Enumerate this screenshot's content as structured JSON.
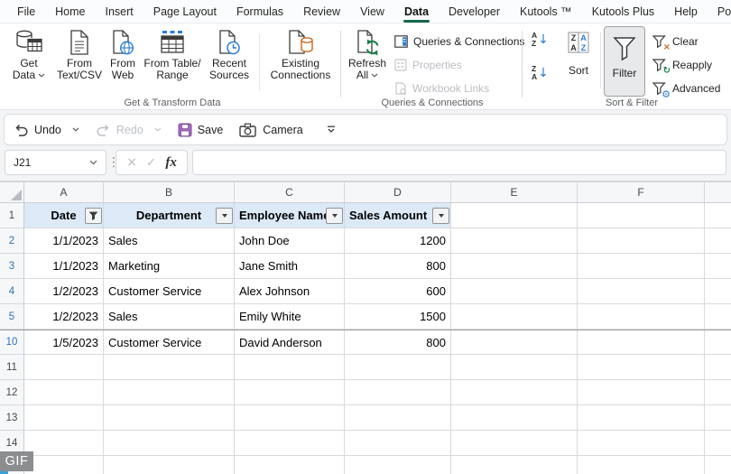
{
  "colors": {
    "accent_green": "#17694a",
    "table_header_fill": "#dce9f7",
    "filtered_row_number_blue": "#2f71b7",
    "blue_accent": "#2b7cd3",
    "orange_accent": "#c9671c",
    "green_refresh": "#17804a",
    "save_icon_purple": "#a86bc2"
  },
  "menu_tabs": {
    "items": [
      {
        "label": "File",
        "active": false
      },
      {
        "label": "Home",
        "active": false
      },
      {
        "label": "Insert",
        "active": false
      },
      {
        "label": "Page Layout",
        "active": false
      },
      {
        "label": "Formulas",
        "active": false
      },
      {
        "label": "Review",
        "active": false
      },
      {
        "label": "View",
        "active": false
      },
      {
        "label": "Data",
        "active": true
      },
      {
        "label": "Developer",
        "active": false
      },
      {
        "label": "Kutools ™",
        "active": false
      },
      {
        "label": "Kutools Plus",
        "active": false
      },
      {
        "label": "Help",
        "active": false
      },
      {
        "label": "Po",
        "active": false
      }
    ]
  },
  "ribbon": {
    "get_transform": {
      "group_label": "Get & Transform Data",
      "get_data": {
        "line1": "Get",
        "line2": "Data"
      },
      "from_text_csv": {
        "line1": "From",
        "line2": "Text/CSV"
      },
      "from_web": {
        "line1": "From",
        "line2": "Web"
      },
      "from_table_range": {
        "line1": "From Table/",
        "line2": "Range"
      },
      "recent_sources": {
        "line1": "Recent",
        "line2": "Sources"
      },
      "existing_connections": {
        "line1": "Existing",
        "line2": "Connections"
      }
    },
    "queries_connections": {
      "group_label": "Queries & Connections",
      "refresh_all": {
        "line1": "Refresh",
        "line2": "All"
      },
      "queries_connections_label": "Queries & Connections",
      "properties_label": "Properties",
      "workbook_links_label": "Workbook Links"
    },
    "sort_filter": {
      "group_label": "Sort & Filter",
      "sort_label": "Sort",
      "filter_label": "Filter",
      "clear_label": "Clear",
      "reapply_label": "Reapply",
      "advanced_label": "Advanced"
    }
  },
  "quick_access": {
    "undo_label": "Undo",
    "redo_label": "Redo",
    "save_label": "Save",
    "camera_label": "Camera"
  },
  "formula_bar": {
    "name_box_value": "J21",
    "cancel_glyph": "×",
    "enter_glyph": "✓",
    "fx_label": "fx",
    "formula_value": ""
  },
  "sheet": {
    "column_headers": [
      "A",
      "B",
      "C",
      "D",
      "E",
      "F",
      ""
    ],
    "header_row": {
      "row_number": "1",
      "cells": [
        {
          "text": "Date",
          "filter": "applied"
        },
        {
          "text": "Department",
          "filter": "dropdown"
        },
        {
          "text": "Employee Name",
          "filter": "dropdown"
        },
        {
          "text": "Sales Amount",
          "filter": "dropdown"
        }
      ]
    },
    "data_rows": [
      {
        "row_number": "2",
        "filtered": true,
        "hidden_rows_above": false,
        "date": "1/1/2023",
        "department": "Sales",
        "employee": "John Doe",
        "amount": "1200"
      },
      {
        "row_number": "3",
        "filtered": true,
        "hidden_rows_above": false,
        "date": "1/1/2023",
        "department": "Marketing",
        "employee": "Jane Smith",
        "amount": "800"
      },
      {
        "row_number": "4",
        "filtered": true,
        "hidden_rows_above": false,
        "date": "1/2/2023",
        "department": "Customer Service",
        "employee": "Alex Johnson",
        "amount": "600"
      },
      {
        "row_number": "5",
        "filtered": true,
        "hidden_rows_above": false,
        "date": "1/2/2023",
        "department": "Sales",
        "employee": "Emily White",
        "amount": "1500"
      },
      {
        "row_number": "10",
        "filtered": true,
        "hidden_rows_above": true,
        "date": "1/5/2023",
        "department": "Customer Service",
        "employee": "David Anderson",
        "amount": "800"
      }
    ],
    "empty_row_numbers": [
      "11",
      "12",
      "13",
      "14",
      ""
    ]
  },
  "watermark": {
    "label": "GIF"
  }
}
